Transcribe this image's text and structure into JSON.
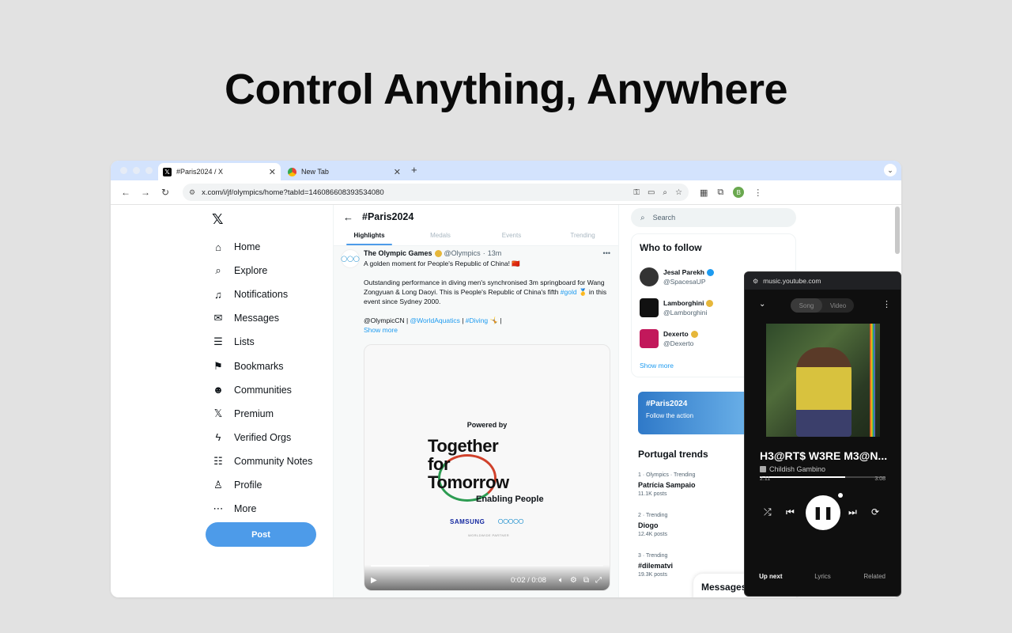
{
  "headline": "Control Anything, Anywhere",
  "browser": {
    "tabs": [
      {
        "title": "#Paris2024 / X",
        "favicon": "x-logo-icon",
        "active": true
      },
      {
        "title": "New Tab",
        "favicon": "chrome-icon",
        "active": false
      }
    ],
    "url": "x.com/i/jf/olympics/home?tabId=146086608393534080",
    "profile_initial": "B"
  },
  "x": {
    "nav": [
      {
        "label": "Home",
        "icon": "home-icon"
      },
      {
        "label": "Explore",
        "icon": "search-icon"
      },
      {
        "label": "Notifications",
        "icon": "bell-icon"
      },
      {
        "label": "Messages",
        "icon": "mail-icon"
      },
      {
        "label": "Lists",
        "icon": "list-icon"
      },
      {
        "label": "Bookmarks",
        "icon": "bookmark-icon"
      },
      {
        "label": "Communities",
        "icon": "communities-icon"
      },
      {
        "label": "Premium",
        "icon": "x-logo-icon"
      },
      {
        "label": "Verified Orgs",
        "icon": "lightning-icon"
      },
      {
        "label": "Community Notes",
        "icon": "community-notes-icon"
      },
      {
        "label": "Profile",
        "icon": "person-icon"
      },
      {
        "label": "More",
        "icon": "more-icon"
      }
    ],
    "post_label": "Post",
    "feed": {
      "title": "#Paris2024",
      "tabs": [
        "Highlights",
        "Medals",
        "Events",
        "Trending"
      ],
      "tweet": {
        "author": "The Olympic Games",
        "handle": "@Olympics",
        "time": "13m",
        "line1": "A golden moment for People's Republic of China! 🇨🇳",
        "line2": "Outstanding performance in diving men's synchronised 3m springboard for Wang Zongyuan & Long Daoyi. This is People's Republic of China's fifth",
        "gold_tag": "#gold",
        "line2_end": "🥇 in this event since Sydney 2000.",
        "mention1": "@OlympicCN |",
        "mention2": "@WorldAquatics",
        "mention_sep": "|",
        "mention3": "#Diving",
        "mention_end": "🤸 |",
        "show_more": "Show more",
        "media": {
          "powered_by": "Powered by",
          "slogan_1": "Together",
          "slogan_2": "for",
          "slogan_3": "Tomorrow",
          "enabling": "Enabling People",
          "sponsor": "SAMSUNG",
          "partner": "WORLDWIDE PARTNER",
          "video_time": "0:02 / 0:08",
          "progress": 0.25
        }
      }
    },
    "right": {
      "search_placeholder": "Search",
      "who_to_follow": "Who to follow",
      "accounts": [
        {
          "name": "Jesal Parekh",
          "handle": "@SpacesaUP",
          "badge": "blue"
        },
        {
          "name": "Lamborghini",
          "handle": "@Lamborghini",
          "badge": "gold"
        },
        {
          "name": "Dexerto",
          "handle": "@Dexerto",
          "badge": "gold"
        }
      ],
      "show_more": "Show more",
      "promo_title": "#Paris2024",
      "promo_sub": "Follow the action",
      "trends_title": "Portugal trends",
      "trends": [
        {
          "meta": "1 · Olympics · Trending",
          "name": "Patrícia Sampaio",
          "posts": "11.1K posts"
        },
        {
          "meta": "2 · Trending",
          "name": "Diogo",
          "posts": "12.4K posts"
        },
        {
          "meta": "3 · Trending",
          "name": "#dilematvi",
          "posts": "19.3K posts"
        }
      ],
      "messages_label": "Messages"
    }
  },
  "yt": {
    "url": "music.youtube.com",
    "toggle": [
      "Song",
      "Video"
    ],
    "title": "H3@RT$ W3RE M3@N...",
    "artist": "Childish Gambino",
    "time_elapsed": "2:11",
    "time_total": "3:08",
    "progress": 0.68,
    "tabs": [
      "Up next",
      "Lyrics",
      "Related"
    ]
  }
}
